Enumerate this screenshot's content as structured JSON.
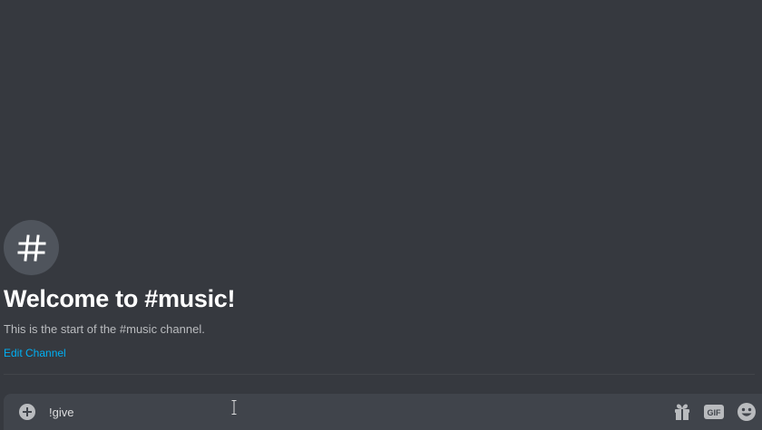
{
  "channel": {
    "icon": "hash-icon",
    "welcome_title": "Welcome to #music!",
    "welcome_subtitle": "This is the start of the #music channel.",
    "edit_link": "Edit Channel"
  },
  "composer": {
    "value": "!give",
    "attach_icon": "plus-circle-icon",
    "gift_icon": "gift-icon",
    "gif_label": "GIF",
    "emoji_icon": "smiley-icon"
  },
  "colors": {
    "background": "#36393f",
    "input_background": "#40444b",
    "link": "#00b0f4",
    "avatar": "#4f545c",
    "muted_text": "#b9bbbe",
    "icon": "#b9bbbe"
  }
}
